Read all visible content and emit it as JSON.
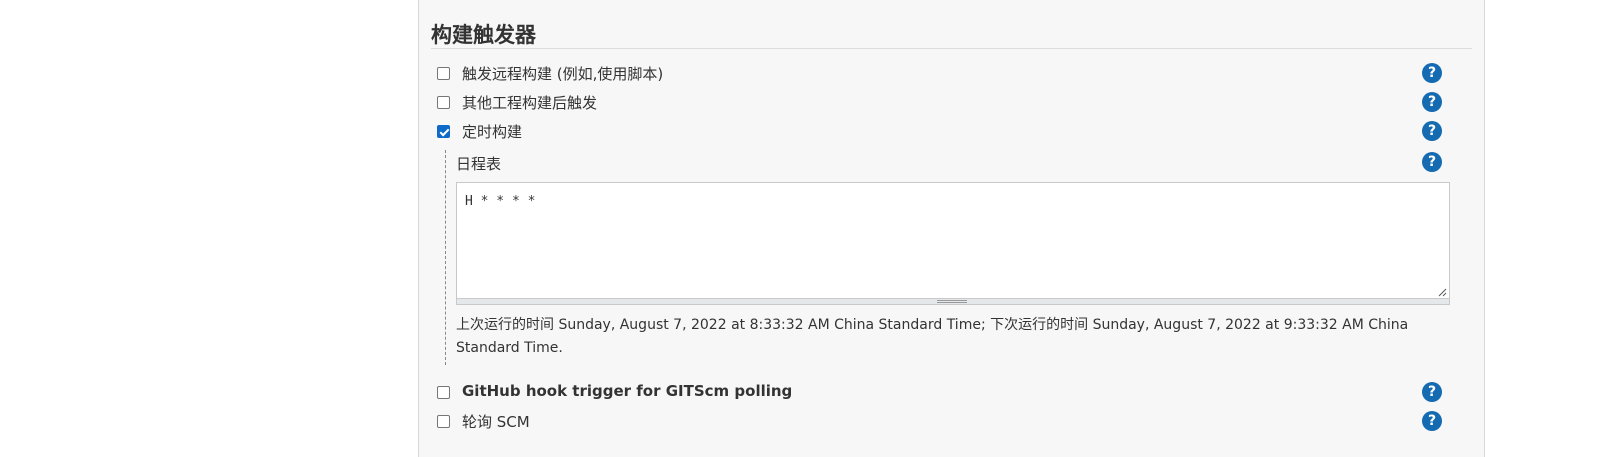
{
  "section": {
    "title": "构建触发器"
  },
  "triggers": [
    {
      "label": "触发远程构建 (例如,使用脚本)",
      "checked": false
    },
    {
      "label": "其他工程构建后触发",
      "checked": false
    },
    {
      "label": "定时构建",
      "checked": true
    },
    {
      "label": "GitHub hook trigger for GITScm polling",
      "checked": false
    },
    {
      "label": "轮询 SCM",
      "checked": false
    }
  ],
  "schedule": {
    "label": "日程表",
    "value": "H * * * *",
    "info": "上次运行的时间 Sunday, August 7, 2022 at 8:33:32 AM China Standard Time; 下次运行的时间 Sunday, August 7, 2022 at 9:33:32 AM China Standard Time."
  },
  "help_glyph": "?",
  "colors": {
    "checkbox_checked": "#0d6ac8",
    "help_icon": "#146bb1",
    "panel_bg": "#f7f7f7"
  }
}
